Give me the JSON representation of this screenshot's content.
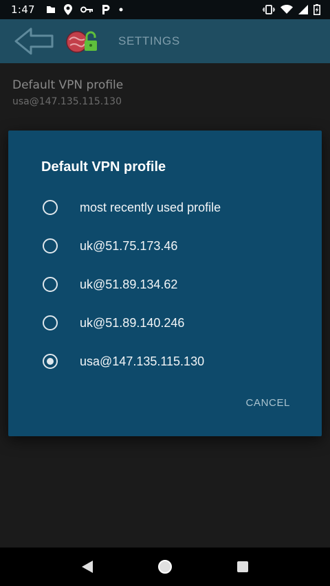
{
  "status_bar": {
    "time": "1:47",
    "icons_left": [
      "file-icon",
      "location-pin-icon",
      "key-icon",
      "parking-icon",
      "dot-icon"
    ],
    "icons_right": [
      "vibrate-icon",
      "wifi-icon",
      "signal-icon",
      "battery-charging-icon"
    ]
  },
  "app_bar": {
    "title": "SETTINGS",
    "back_icon": "back-arrow-icon",
    "logo_icon": "vpn-logo-icon"
  },
  "settings": {
    "title": "Default VPN profile",
    "summary": "usa@147.135.115.130"
  },
  "dialog": {
    "title": "Default VPN profile",
    "options": [
      {
        "label": "most recently used profile",
        "checked": false
      },
      {
        "label": "uk@51.75.173.46",
        "checked": false
      },
      {
        "label": "uk@51.89.134.62",
        "checked": false
      },
      {
        "label": "uk@51.89.140.246",
        "checked": false
      },
      {
        "label": "usa@147.135.115.130",
        "checked": true
      }
    ],
    "cancel_label": "CANCEL"
  },
  "nav_bar": {
    "buttons": [
      "back-triangle-icon",
      "home-circle-icon",
      "recents-square-icon"
    ]
  },
  "colors": {
    "app_bar": "#1f4d61",
    "dialog": "#0e4a6b",
    "background": "#1b1b1b"
  }
}
